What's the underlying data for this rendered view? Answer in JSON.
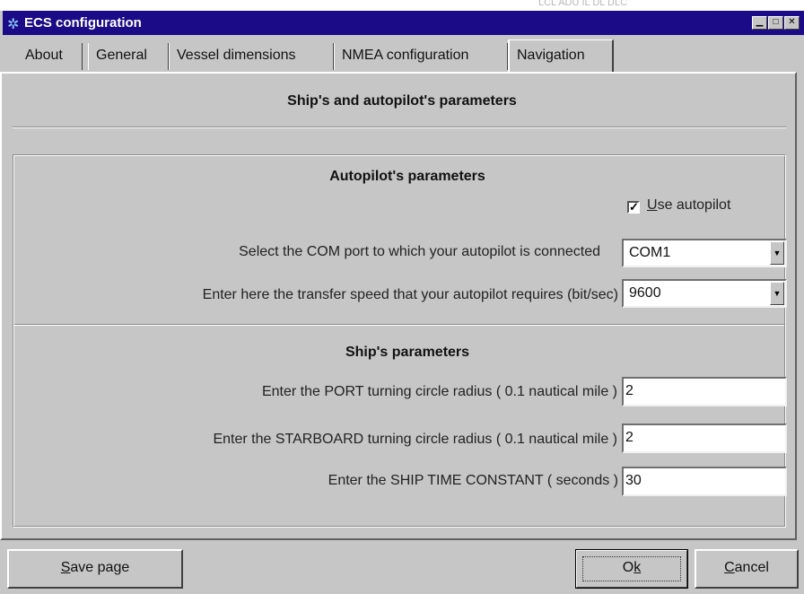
{
  "window": {
    "title": "ECS configuration",
    "background_ghost_text": "LCL ADU IL DL DLC"
  },
  "tabs": [
    {
      "label": "About"
    },
    {
      "label": "General"
    },
    {
      "label": "Vessel dimensions"
    },
    {
      "label": "NMEA configuration"
    },
    {
      "label": "Navigation",
      "active": true
    }
  ],
  "page": {
    "heading": "Ship's and autopilot's parameters",
    "autopilot": {
      "heading": "Autopilot's parameters",
      "use_autopilot_label_prefix": "",
      "use_autopilot_accel": "U",
      "use_autopilot_rest": "se autopilot",
      "use_autopilot_checked": true,
      "check_mark": "✓",
      "com_port_label": "Select the COM port to which your autopilot is connected",
      "com_port_value": "COM1",
      "speed_label": "Enter here the transfer speed that your autopilot requires (bit/sec)",
      "speed_value": "9600"
    },
    "ship": {
      "heading": "Ship's parameters",
      "port_radius_label": "Enter the PORT turning circle radius ( 0.1 nautical mile )",
      "port_radius_value": "2",
      "starboard_radius_label": "Enter the STARBOARD turning circle radius ( 0.1 nautical mile )",
      "starboard_radius_value": "2",
      "time_constant_label": "Enter the SHIP TIME CONSTANT ( seconds )",
      "time_constant_value": "30"
    }
  },
  "buttons": {
    "save_accel": "S",
    "save_rest": "ave page",
    "ok_prefix": "O",
    "ok_accel": "k",
    "cancel_accel": "C",
    "cancel_rest": "ancel"
  },
  "icons": {
    "app": "ship-app-icon",
    "minimize": "minimize-icon",
    "maximize": "maximize-icon",
    "close": "close-icon",
    "dropdown": "dropdown-arrow-icon"
  },
  "colors": {
    "titlebar": "#1c0b86",
    "face": "#c6c6c6",
    "field": "#ffffff"
  }
}
